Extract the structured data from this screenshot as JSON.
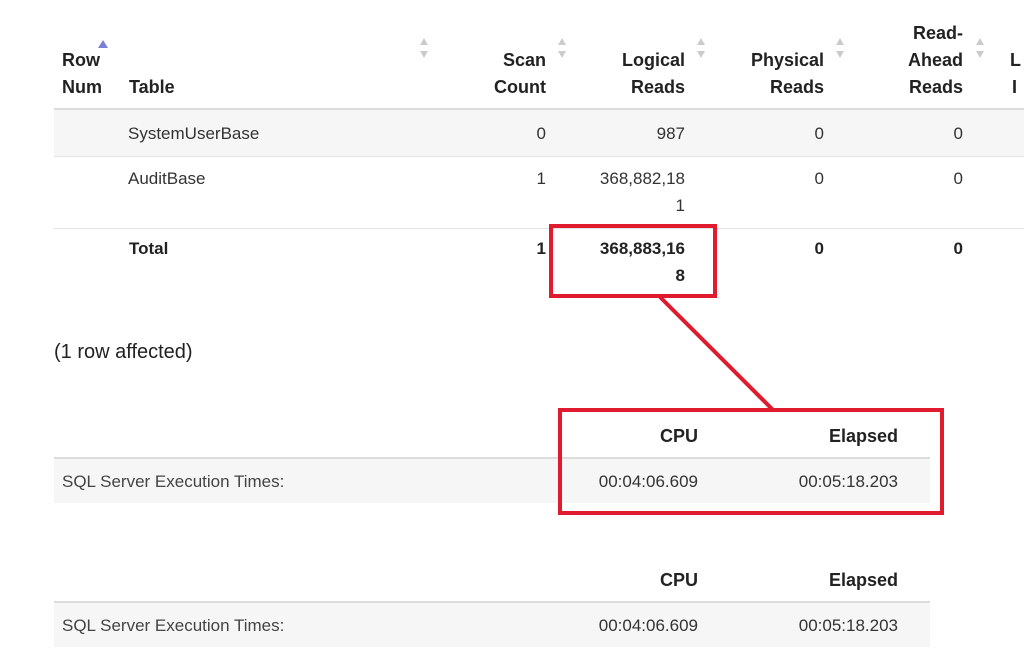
{
  "stats_table": {
    "columns": [
      {
        "key": "row_num",
        "lines": [
          "Row",
          "Num"
        ],
        "sorted": "asc"
      },
      {
        "key": "table",
        "lines": [
          "",
          "Table"
        ],
        "sorted": "none"
      },
      {
        "key": "scan_count",
        "lines": [
          "Scan",
          "Count"
        ],
        "sorted": "none"
      },
      {
        "key": "logical_reads",
        "lines": [
          "Logical",
          "Reads"
        ],
        "sorted": "none"
      },
      {
        "key": "physical_reads",
        "lines": [
          "Physical",
          "Reads"
        ],
        "sorted": "none"
      },
      {
        "key": "read_ahead_reads",
        "lines": [
          "Read-",
          "Ahead",
          "Reads"
        ],
        "sorted": "none"
      },
      {
        "key": "clipped",
        "lines": [
          "L",
          "I"
        ],
        "sorted": "none"
      }
    ],
    "rows": [
      {
        "row_num": "",
        "table": "SystemUserBase",
        "scan_count": "0",
        "logical_reads": "987",
        "physical_reads": "0",
        "read_ahead_reads": "0"
      },
      {
        "row_num": "",
        "table": "AuditBase",
        "scan_count": "1",
        "logical_reads_lines": [
          "368,882,18",
          "1"
        ],
        "physical_reads": "0",
        "read_ahead_reads": "0"
      }
    ],
    "total": {
      "label": "Total",
      "scan_count": "1",
      "logical_reads_lines": [
        "368,883,16",
        "8"
      ],
      "physical_reads": "0",
      "read_ahead_reads": "0"
    }
  },
  "rows_affected": "(1 row affected)",
  "exec_times": [
    {
      "header_cpu": "CPU",
      "header_elapsed": "Elapsed",
      "label": "SQL Server Execution Times:",
      "cpu": "00:04:06.609",
      "elapsed": "00:05:18.203"
    },
    {
      "header_cpu": "CPU",
      "header_elapsed": "Elapsed",
      "label": "SQL Server Execution Times:",
      "cpu": "00:04:06.609",
      "elapsed": "00:05:18.203"
    }
  ],
  "colors": {
    "highlight": "#e01b2e",
    "sort_active": "#7b7fd6",
    "sort_idle": "#cccccc"
  }
}
